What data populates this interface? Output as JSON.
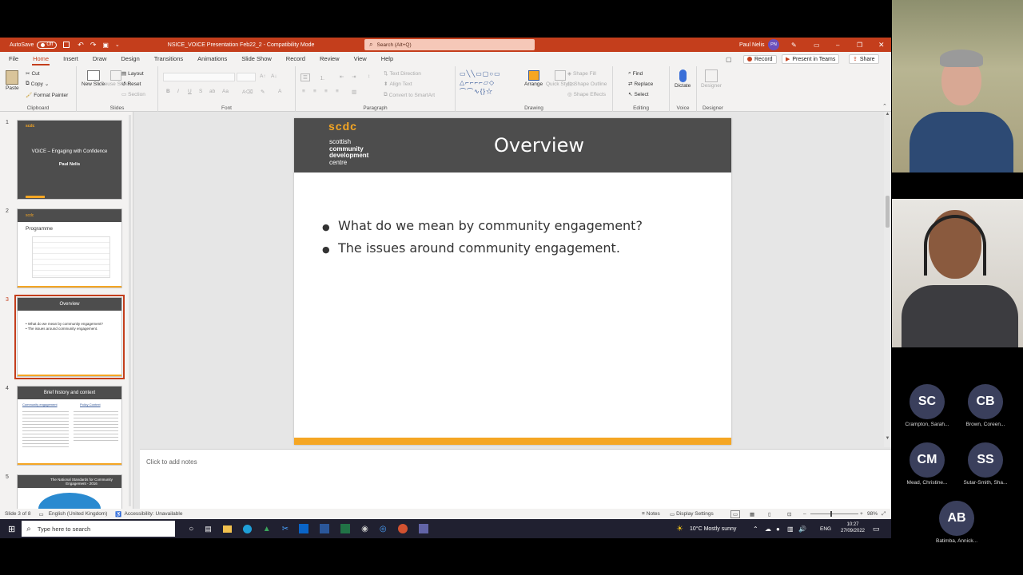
{
  "title_bar": {
    "autosave_label": "AutoSave",
    "autosave_state": "Off",
    "document_title": "NSICE_VOICE Presentation Feb22_2  -  Compatibility Mode",
    "search_placeholder": "Search (Alt+Q)",
    "user_name": "Paul Nelis",
    "user_initials": "PN"
  },
  "ribbon_tabs": [
    "File",
    "Home",
    "Insert",
    "Draw",
    "Design",
    "Transitions",
    "Animations",
    "Slide Show",
    "Record",
    "Review",
    "View",
    "Help"
  ],
  "ribbon_actions": {
    "record": "Record",
    "present": "Present in Teams",
    "share": "Share"
  },
  "ribbon": {
    "clipboard": {
      "paste": "Paste",
      "cut": "Cut",
      "copy": "Copy",
      "format_painter": "Format Painter",
      "label": "Clipboard"
    },
    "slides": {
      "new_slide": "New Slide",
      "reuse_slides": "Reuse Slides",
      "layout": "Layout",
      "reset": "Reset",
      "section": "Section",
      "label": "Slides"
    },
    "font": {
      "label": "Font"
    },
    "paragraph": {
      "text_direction": "Text Direction",
      "align_text": "Align Text",
      "convert_smartart": "Convert to SmartArt",
      "label": "Paragraph"
    },
    "drawing": {
      "arrange": "Arrange",
      "quick_styles": "Quick Styles",
      "shape_fill": "Shape Fill",
      "shape_outline": "Shape Outline",
      "shape_effects": "Shape Effects",
      "label": "Drawing"
    },
    "editing": {
      "find": "Find",
      "replace": "Replace",
      "select": "Select",
      "label": "Editing"
    },
    "voice": {
      "dictate": "Dictate",
      "label": "Voice"
    },
    "designer": {
      "designer": "Designer",
      "label": "Designer"
    }
  },
  "thumbnails": [
    {
      "num": "1",
      "title": "VOiCE – Engaging with Confidence",
      "subtitle": "Paul Nelis"
    },
    {
      "num": "2",
      "title": "Programme"
    },
    {
      "num": "3",
      "title": "Overview",
      "bullets": [
        "What do we mean by community engagement?",
        "The issues around community engagement."
      ]
    },
    {
      "num": "4",
      "title": "Brief history and context",
      "left_heading": "Community engagement",
      "right_heading": "Policy Context"
    },
    {
      "num": "5",
      "title": "The National Standards for Community Engagement - 2016"
    }
  ],
  "slide": {
    "logo": "scdc",
    "logo_sub1": "scottish",
    "logo_sub2": "community",
    "logo_sub3": "development",
    "logo_sub4": "centre",
    "title": "Overview",
    "bullets": [
      "What do we mean by community engagement?",
      "The issues around community engagement."
    ]
  },
  "notes_placeholder": "Click to add notes",
  "status_bar": {
    "slide_info": "Slide 3 of 8",
    "language": "English (United Kingdom)",
    "accessibility": "Accessibility: Unavailable",
    "notes": "Notes",
    "display_settings": "Display Settings",
    "zoom": "98%"
  },
  "taskbar": {
    "search_placeholder": "Type here to search",
    "weather": "10°C  Mostly sunny",
    "lang": "ENG",
    "time": "10:27",
    "date": "27/09/2022"
  },
  "participants": [
    {
      "initials": "SC",
      "name": "Crampton, Sarah..."
    },
    {
      "initials": "CB",
      "name": "Brown, Coreen..."
    },
    {
      "initials": "CM",
      "name": "Mead, Christine..."
    },
    {
      "initials": "SS",
      "name": "Sutar-Smith, Sha..."
    },
    {
      "initials": "AB",
      "name": "Batimba, Annick..."
    }
  ],
  "colors": {
    "accent": "#c43e1c",
    "slide_header": "#4d4d4d",
    "slide_footer": "#f5a623"
  }
}
